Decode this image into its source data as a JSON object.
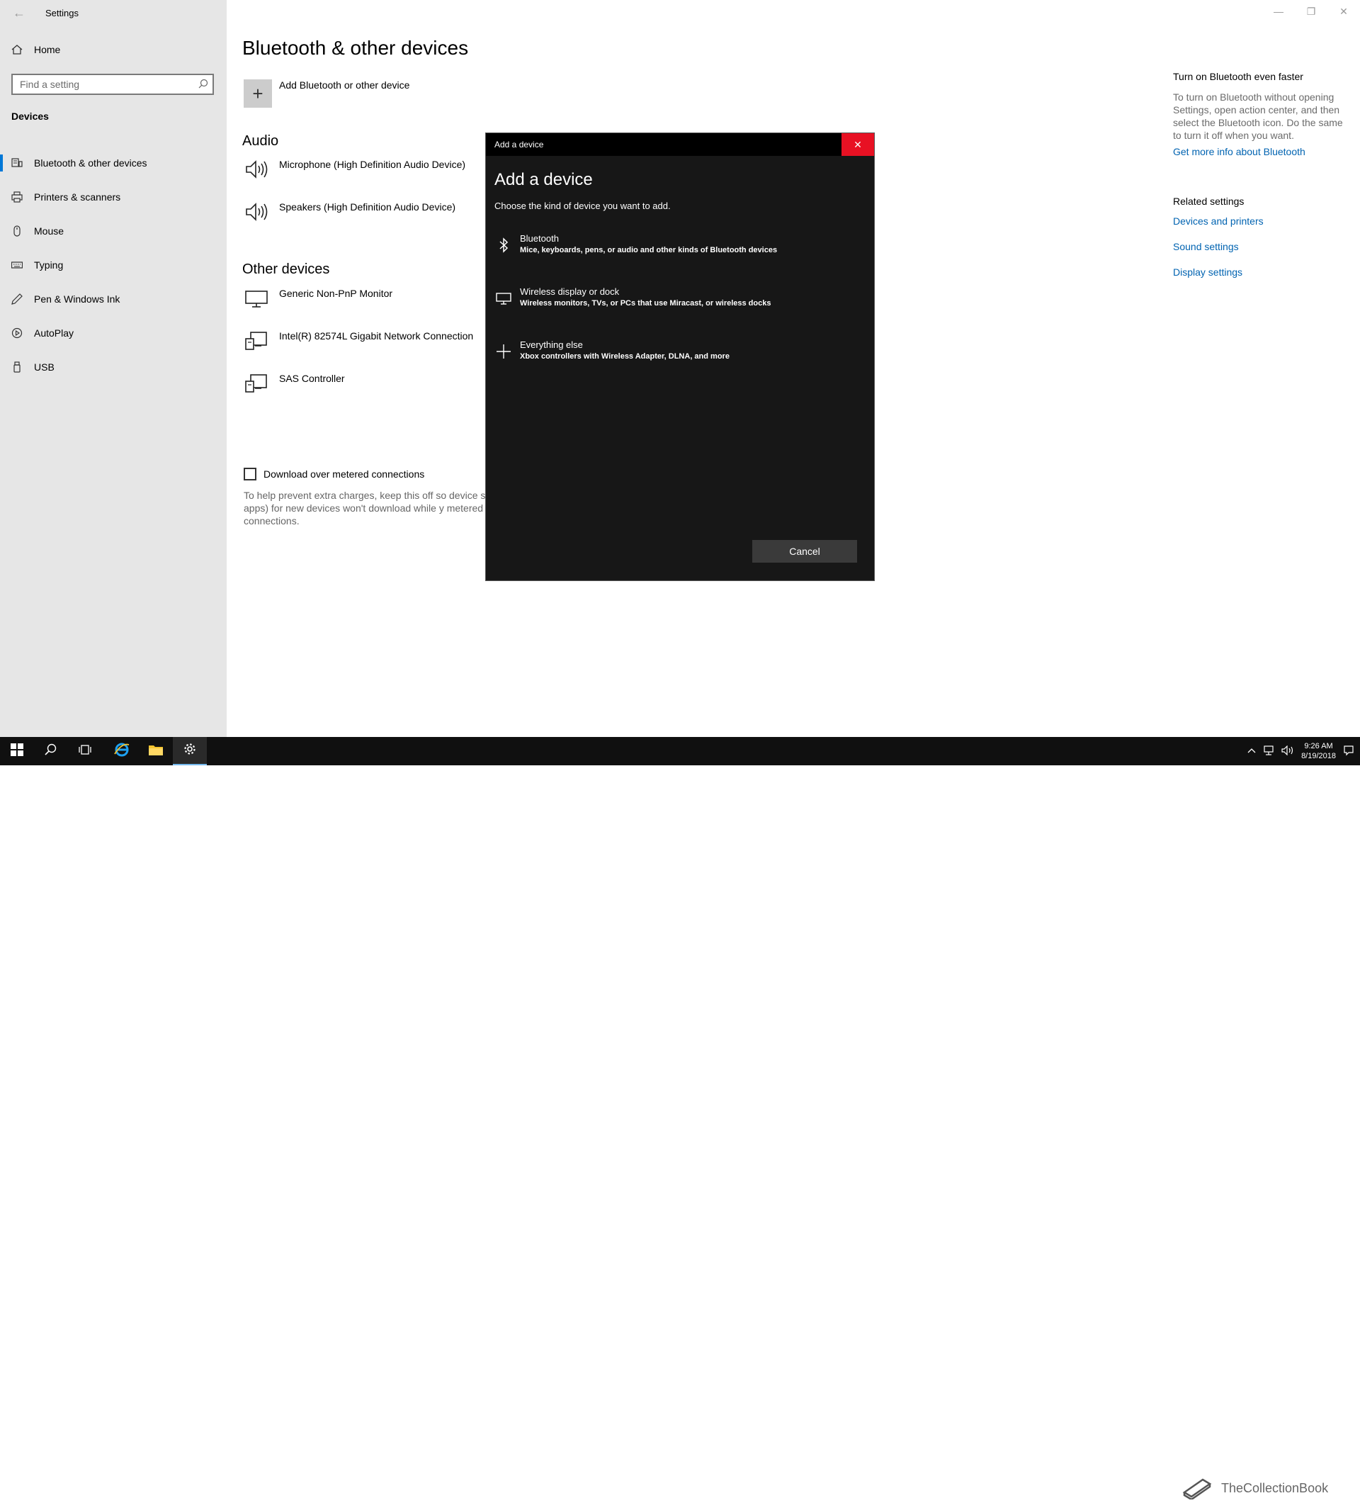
{
  "window": {
    "title": "Settings",
    "minimize_glyph": "—",
    "maximize_glyph": "❐",
    "close_glyph": "✕"
  },
  "sidebar": {
    "home_label": "Home",
    "search_placeholder": "Find a setting",
    "section_title": "Devices",
    "items": [
      {
        "label": "Bluetooth & other devices",
        "icon": "bluetooth-devices-icon",
        "active": true
      },
      {
        "label": "Printers & scanners",
        "icon": "printer-icon"
      },
      {
        "label": "Mouse",
        "icon": "mouse-icon"
      },
      {
        "label": "Typing",
        "icon": "keyboard-icon"
      },
      {
        "label": "Pen & Windows Ink",
        "icon": "pen-icon"
      },
      {
        "label": "AutoPlay",
        "icon": "autoplay-icon"
      },
      {
        "label": "USB",
        "icon": "usb-icon"
      }
    ]
  },
  "main": {
    "page_title": "Bluetooth & other devices",
    "add_device_label": "Add Bluetooth or other device",
    "audio": {
      "title": "Audio",
      "devices": [
        "Microphone (High Definition Audio Device)",
        "Speakers (High Definition Audio Device)"
      ]
    },
    "other": {
      "title": "Other devices",
      "devices": [
        "Generic Non-PnP Monitor",
        "Intel(R) 82574L Gigabit Network Connection",
        "SAS Controller"
      ]
    },
    "metered": {
      "label": "Download over metered connections",
      "checked": false,
      "description": "To help prevent extra charges, keep this off so device so info, and apps) for new devices won't download while y metered Internet connections."
    }
  },
  "right_panel": {
    "heading": "Turn on Bluetooth even faster",
    "text": "To turn on Bluetooth without opening Settings, open action center, and then select the Bluetooth icon. Do the same to turn it off when you want.",
    "info_link": "Get more info about Bluetooth",
    "related_heading": "Related settings",
    "links": [
      "Devices and printers",
      "Sound settings",
      "Display settings"
    ]
  },
  "dialog": {
    "window_title": "Add a device",
    "heading": "Add a device",
    "subtitle": "Choose the kind of device you want to add.",
    "options": [
      {
        "title": "Bluetooth",
        "description": "Mice, keyboards, pens, or audio and other kinds of Bluetooth devices",
        "icon": "bluetooth-icon"
      },
      {
        "title": "Wireless display or dock",
        "description": "Wireless monitors, TVs, or PCs that use Miracast, or wireless docks",
        "icon": "monitor-icon"
      },
      {
        "title": "Everything else",
        "description": "Xbox controllers with Wireless Adapter, DLNA, and more",
        "icon": "plus-icon"
      }
    ],
    "cancel_label": "Cancel",
    "close_accent": "#e81123"
  },
  "taskbar": {
    "time": "9:26 AM",
    "date": "8/19/2018",
    "watermark": "TheCollectionBook"
  },
  "colors": {
    "accent": "#0078d7",
    "link": "#0063b1",
    "sidebar_bg": "#e6e6e6",
    "dialog_bg": "#171717"
  }
}
